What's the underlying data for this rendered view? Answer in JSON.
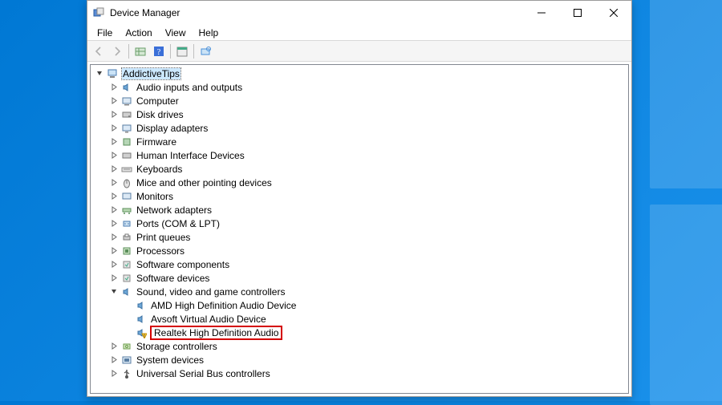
{
  "window": {
    "title": "Device Manager"
  },
  "menu": {
    "file": "File",
    "action": "Action",
    "view": "View",
    "help": "Help"
  },
  "toolbar": {
    "back": "Back",
    "forward": "Forward",
    "show_hidden": "Show hidden",
    "help": "Help",
    "properties": "Properties",
    "scan": "Scan"
  },
  "tree": {
    "root": {
      "label": "AddictiveTips",
      "expanded": true
    },
    "categories": [
      {
        "label": "Audio inputs and outputs",
        "icon": "speaker-icon",
        "expandable": true
      },
      {
        "label": "Computer",
        "icon": "computer-icon",
        "expandable": true
      },
      {
        "label": "Disk drives",
        "icon": "disk-icon",
        "expandable": true
      },
      {
        "label": "Display adapters",
        "icon": "display-icon",
        "expandable": true
      },
      {
        "label": "Firmware",
        "icon": "firmware-icon",
        "expandable": true
      },
      {
        "label": "Human Interface Devices",
        "icon": "hid-icon",
        "expandable": true
      },
      {
        "label": "Keyboards",
        "icon": "keyboard-icon",
        "expandable": true
      },
      {
        "label": "Mice and other pointing devices",
        "icon": "mouse-icon",
        "expandable": true
      },
      {
        "label": "Monitors",
        "icon": "monitor-icon",
        "expandable": true
      },
      {
        "label": "Network adapters",
        "icon": "network-icon",
        "expandable": true
      },
      {
        "label": "Ports (COM & LPT)",
        "icon": "port-icon",
        "expandable": true
      },
      {
        "label": "Print queues",
        "icon": "printer-icon",
        "expandable": true
      },
      {
        "label": "Processors",
        "icon": "cpu-icon",
        "expandable": true
      },
      {
        "label": "Software components",
        "icon": "software-icon",
        "expandable": true
      },
      {
        "label": "Software devices",
        "icon": "software-icon",
        "expandable": true
      },
      {
        "label": "Sound, video and game controllers",
        "icon": "speaker-icon",
        "expandable": true,
        "expanded": true,
        "children": [
          {
            "label": "AMD High Definition Audio Device",
            "icon": "speaker-icon"
          },
          {
            "label": "Avsoft Virtual Audio Device",
            "icon": "speaker-icon"
          },
          {
            "label": "Realtek High Definition Audio",
            "icon": "speaker-warn-icon",
            "highlighted": true
          }
        ]
      },
      {
        "label": "Storage controllers",
        "icon": "storage-icon",
        "expandable": true
      },
      {
        "label": "System devices",
        "icon": "system-icon",
        "expandable": true
      },
      {
        "label": "Universal Serial Bus controllers",
        "icon": "usb-icon",
        "expandable": true
      }
    ]
  }
}
